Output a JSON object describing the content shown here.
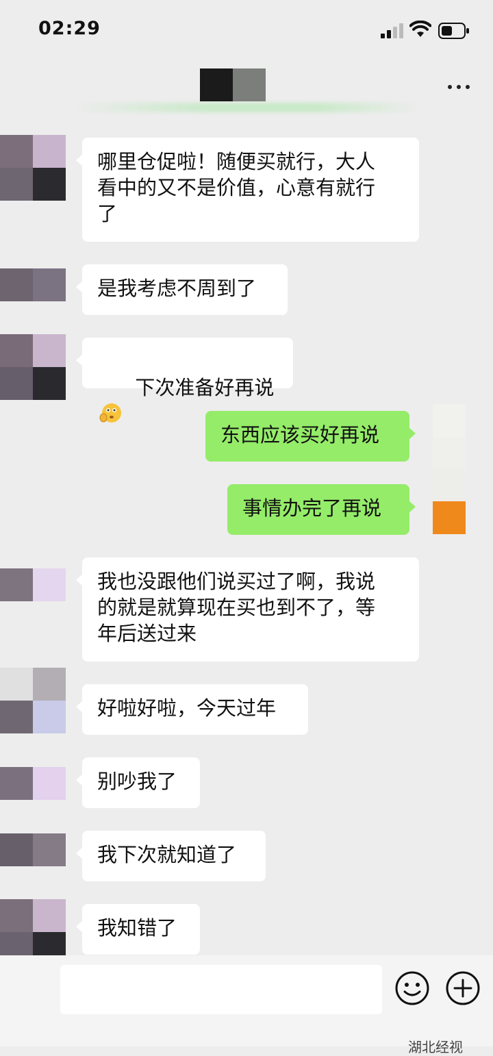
{
  "status_bar": {
    "time": "02:29"
  },
  "header": {
    "more_icon": "more-horizontal-icon"
  },
  "messages": [
    {
      "side": "left",
      "text": "哪里仓促啦！随便买就行，大人\n看中的又不是价值，心意有就行\n了"
    },
    {
      "side": "left",
      "text": "是我考虑不周到了"
    },
    {
      "side": "left",
      "text": "下次准备好再说",
      "emoji": "face-emoji-icon"
    },
    {
      "side": "right",
      "text": "东西应该买好再说"
    },
    {
      "side": "right",
      "text": "事情办完了再说"
    },
    {
      "side": "left",
      "text": "我也没跟他们说买过了啊，我说\n的就是就算现在买也到不了，等\n年后送过来"
    },
    {
      "side": "left",
      "text": "好啦好啦，今天过年"
    },
    {
      "side": "left",
      "text": "别吵我了"
    },
    {
      "side": "left",
      "text": "我下次就知道了"
    },
    {
      "side": "left",
      "text": "我知错了"
    }
  ],
  "input_bar": {
    "placeholder": "",
    "emoji_icon": "smiley-icon",
    "plus_icon": "plus-circle-icon"
  },
  "watermark": {
    "text": "湖北经视"
  },
  "colors": {
    "background": "#ededed",
    "incoming_bubble": "#ffffff",
    "outgoing_bubble": "#95ec69"
  }
}
